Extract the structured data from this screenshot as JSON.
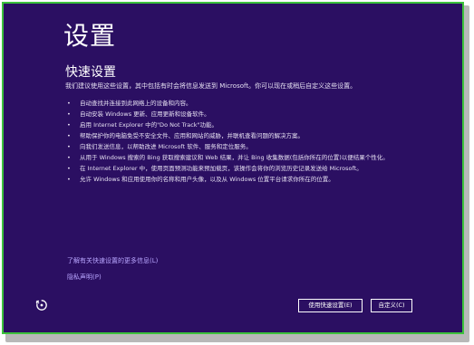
{
  "page": {
    "title": "设置",
    "subtitle": "快速设置",
    "intro": "我们建议使用这些设置，其中包括有时会将信息发送到 Microsoft。你可以现在或稍后自定义这些设置。",
    "bullets": [
      "自动查找并连接到此网络上的设备和内容。",
      "自动安装 Windows 更新、应用更新和设备软件。",
      "启用 Internet Explorer 中的\"Do Not Track\"功能。",
      "帮助保护你的电脑免受不安全文件、应用和网站的威胁，并联机查看问题的解决方案。",
      "向我们发送信息，以帮助改进 Microsoft 软件、服务和定位服务。",
      "从用于 Windows 搜索的 Bing 获取搜索建议和 Web 结果，并让 Bing 收集数据(包括你所在的位置)以便结果个性化。",
      "在 Internet Explorer 中，使用页面预测功能来预加载页，该操作会将你的浏览历史记录发送给 Microsoft。",
      "允许 Windows 和应用使用你的名称和用户头像，以及从 Windows 位置平台请求你所在的位置。"
    ],
    "bullet_glyph": "•",
    "learn_more_link": "了解有关快速设置的更多信息(L)",
    "privacy_link": "隐私声明(P)",
    "use_express_button": "使用快速设置(E)",
    "customize_button": "自定义(C)"
  },
  "colors": {
    "background": "#2b0f62",
    "frame_border": "#3cc23c",
    "link": "#b9a6ff",
    "text": "#ffffff"
  },
  "icons": {
    "ease_of_access": "ease-of-access-icon"
  }
}
